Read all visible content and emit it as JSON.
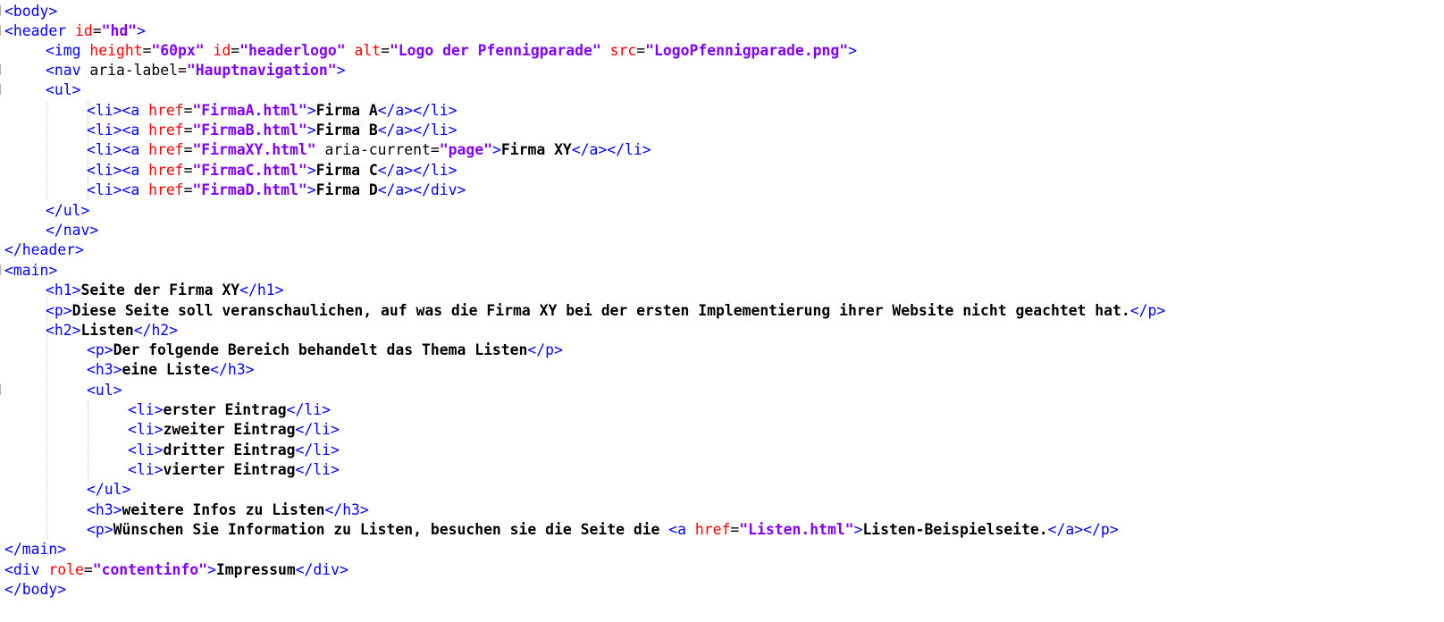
{
  "editor": {
    "language": "HTML",
    "colors": {
      "tag": "#0000ff",
      "attribute": "#ff0000",
      "value": "#8000ff",
      "text": "#000000"
    }
  },
  "code": {
    "l01": {
      "t1": "<body>"
    },
    "l02": {
      "t1": "<header ",
      "a1": "id",
      "q1": "=",
      "v1": "\"hd\"",
      "t2": ">"
    },
    "l03": {
      "t1": "<img ",
      "a1": "height",
      "q1": "=",
      "v1": "\"60px\"",
      "a2": "id",
      "q2": "=",
      "v2": "\"headerlogo\"",
      "a3": "alt",
      "q3": "=",
      "v3": "\"Logo der Pfennigparade\"",
      "a4": "src",
      "q4": "=",
      "v4": "\"LogoPfennigparade.png\"",
      "t2": ">"
    },
    "l04": {
      "t1": "<nav ",
      "p1": "aria-label",
      "q1": "=",
      "v1": "\"Hauptnavigation\"",
      "t2": ">"
    },
    "l05": {
      "t1": "<ul>"
    },
    "l06": {
      "t1": "<li><a ",
      "a1": "href",
      "q1": "=",
      "v1": "\"FirmaA.html\"",
      "t2": ">",
      "x1": "Firma A",
      "t3": "</a></li>"
    },
    "l07": {
      "t1": "<li><a ",
      "a1": "href",
      "q1": "=",
      "v1": "\"FirmaB.html\"",
      "t2": ">",
      "x1": "Firma B",
      "t3": "</a></li>"
    },
    "l08": {
      "t1": "<li><a ",
      "a1": "href",
      "q1": "=",
      "v1": "\"FirmaXY.html\"",
      "p1": "aria-current",
      "q2": "=",
      "v2": "\"page\"",
      "t2": ">",
      "x1": "Firma XY",
      "t3": "</a></li>"
    },
    "l09": {
      "t1": "<li><a ",
      "a1": "href",
      "q1": "=",
      "v1": "\"FirmaC.html\"",
      "t2": ">",
      "x1": "Firma C",
      "t3": "</a></li>"
    },
    "l10": {
      "t1": "<li><a ",
      "a1": "href",
      "q1": "=",
      "v1": "\"FirmaD.html\"",
      "t2": ">",
      "x1": "Firma D",
      "t3": "</a></div>"
    },
    "l11": {
      "t1": "</ul>"
    },
    "l12": {
      "t1": "</nav>"
    },
    "l13": {
      "t1": "</header>"
    },
    "l14": {
      "t1": "<main>"
    },
    "l15": {
      "t1": "<h1>",
      "x1": "Seite der Firma XY",
      "t2": "</h1>"
    },
    "l16": {
      "t1": "<p>",
      "x1": "Diese Seite soll veranschaulichen, auf was die Firma XY bei der ersten Implementierung ihrer Website nicht geachtet hat.",
      "t2": "</p>"
    },
    "l17": {
      "t1": "<h2>",
      "x1": "Listen",
      "t2": "</h2>"
    },
    "l18": {
      "t1": "<p>",
      "x1": "Der folgende Bereich behandelt das Thema Listen",
      "t2": "</p>"
    },
    "l19": {
      "t1": "<h3>",
      "x1": "eine Liste",
      "t2": "</h3>"
    },
    "l20": {
      "t1": "<ul>"
    },
    "l21": {
      "t1": "<li>",
      "x1": "erster Eintrag",
      "t2": "</li>"
    },
    "l22": {
      "t1": "<li>",
      "x1": "zweiter Eintrag",
      "t2": "</li>"
    },
    "l23": {
      "t1": "<li>",
      "x1": "dritter Eintrag",
      "t2": "</li>"
    },
    "l24": {
      "t1": "<li>",
      "x1": "vierter Eintrag",
      "t2": "</li>"
    },
    "l25": {
      "t1": "</ul>"
    },
    "l26": {
      "t1": "<h3>",
      "x1": "weitere Infos zu Listen",
      "t2": "</h3>"
    },
    "l27": {
      "t1": "<p>",
      "x1": "Wünschen Sie Information zu Listen, besuchen sie die Seite die ",
      "t2": "<a ",
      "a1": "href",
      "q1": "=",
      "v1": "\"Listen.html\"",
      "t3": ">",
      "x2": "Listen-Beispielseite.",
      "t4": "</a></p>"
    },
    "l28": {
      "t1": "</main>"
    },
    "l29": {
      "t1": "<div ",
      "a1": "role",
      "q1": "=",
      "v1": "\"contentinfo\"",
      "t2": ">",
      "x1": "Impressum",
      "t3": "</div>"
    },
    "l30": {
      "t1": "</body>"
    }
  }
}
